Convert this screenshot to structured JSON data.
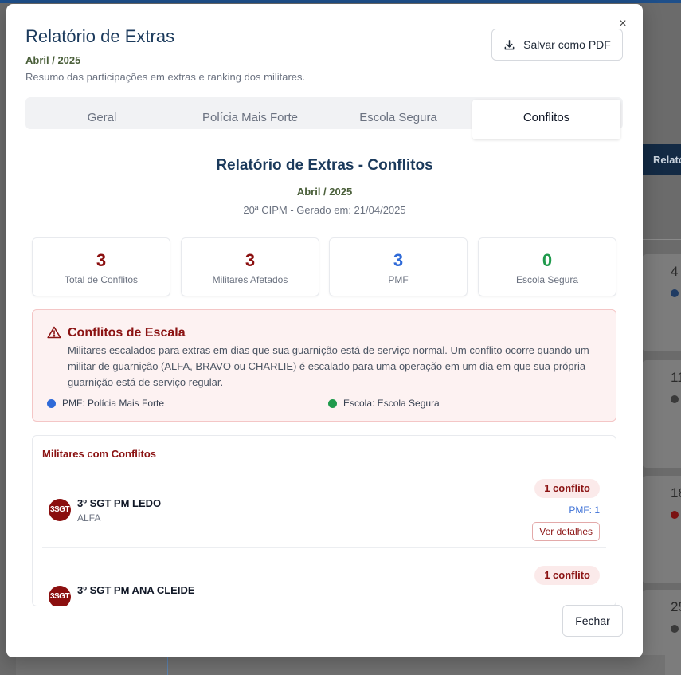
{
  "background": {
    "navbar_label": "Relató",
    "cards": [
      {
        "num": "4",
        "dot": "#1f3b63"
      },
      {
        "num": "11",
        "dot": "#3a3a3a"
      },
      {
        "num": "18",
        "dot": "#7a1212"
      },
      {
        "num": "25",
        "dot": "#3a3a3a"
      }
    ]
  },
  "modal": {
    "close_label": "×",
    "title": "Relatório de Extras",
    "period": "Abril / 2025",
    "description": "Resumo das participações em extras e ranking dos militares.",
    "pdf_button": "Salvar como PDF",
    "tabs": [
      {
        "label": "Geral",
        "active": false
      },
      {
        "label": "Polícia Mais Forte",
        "active": false
      },
      {
        "label": "Escola Segura",
        "active": false
      },
      {
        "label": "Conflitos",
        "active": true
      }
    ]
  },
  "report": {
    "title": "Relatório de Extras - Conflitos",
    "period": "Abril / 2025",
    "generated": "20ª CIPM - Gerado em: 21/04/2025"
  },
  "stats": [
    {
      "value": "3",
      "label": "Total de Conflitos",
      "color": "#8b0f0f"
    },
    {
      "value": "3",
      "label": "Militares Afetados",
      "color": "#8b0f0f"
    },
    {
      "value": "3",
      "label": "PMF",
      "color": "#2f6ad8"
    },
    {
      "value": "0",
      "label": "Escola Segura",
      "color": "#1f9a4c"
    }
  ],
  "alert": {
    "title": "Conflitos de Escala",
    "text": "Militares escalados para extras em dias que sua guarnição está de serviço normal. Um conflito ocorre quando um militar de guarnição (ALFA, BRAVO ou CHARLIE) é escalado para uma operação em um dia em que sua própria guarnição está de serviço regular.",
    "legend": [
      {
        "label": "PMF: Polícia Mais Forte",
        "color": "#2f6ad8"
      },
      {
        "label": "Escola: Escola Segura",
        "color": "#1f9a4c"
      }
    ]
  },
  "militares": {
    "title": "Militares com Conflitos",
    "items": [
      {
        "avatar": "3SGT",
        "name": "3º SGT PM LEDO",
        "unit": "ALFA",
        "badge": "1 conflito",
        "pmf": "PMF: 1",
        "details": "Ver detalhes"
      },
      {
        "avatar": "3SGT",
        "name": "3º SGT PM ANA CLEIDE",
        "unit": "",
        "badge": "1 conflito",
        "pmf": "",
        "details": ""
      }
    ]
  },
  "footer": {
    "close_button": "Fechar"
  }
}
